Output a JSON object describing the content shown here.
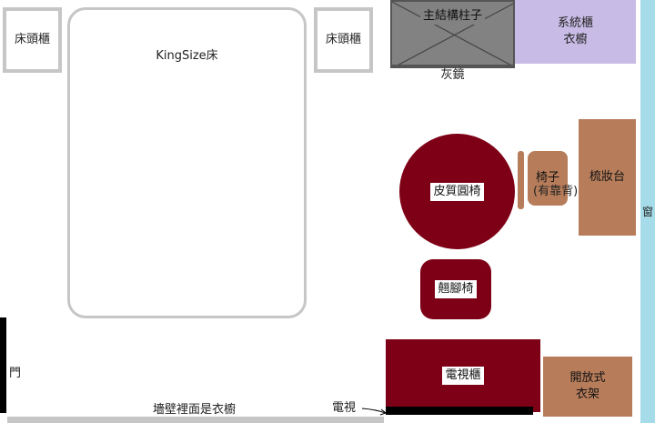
{
  "nightstand_left": "床頭櫃",
  "bed": "KingSize床",
  "nightstand_right": "床頭櫃",
  "pillar": "主結構柱子",
  "system_wardrobe": [
    "系統櫃",
    "衣櫥"
  ],
  "gray_mirror": "灰鏡",
  "leather_chair": "皮質圓椅",
  "chair": [
    "椅子",
    "(有靠背)"
  ],
  "vanity": "梳妝台",
  "window": "窗",
  "stool": "翹腳椅",
  "door": "門",
  "tv_cabinet": "電視櫃",
  "open_rack": [
    "開放式",
    "衣架"
  ],
  "wall_wardrobe": "墻壁裡面是衣櫥",
  "tv": "電視",
  "colors": {
    "maroon": "#7e0016",
    "brown": "#b77d5b",
    "lavender": "#c8bce6",
    "window_blue": "#a6dce9",
    "outline_gray": "#c6c6c6",
    "pillar_gray": "#828282"
  }
}
